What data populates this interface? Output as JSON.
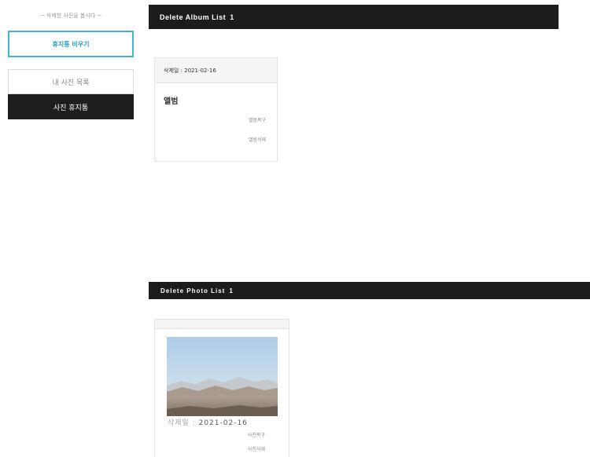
{
  "sidebar": {
    "hint": "~ 삭제한 사진을 봅시다 ~",
    "empty_trash_label": "휴지통 비우기",
    "nav": {
      "my_photos": "내 사진 목록",
      "photo_trash": "사진 휴지통"
    }
  },
  "album_section": {
    "title": "Delete Album List",
    "count": "1",
    "cards": [
      {
        "deleted_date": "삭제일 : 2021-02-16",
        "title": "앨범",
        "restore_label": "앨범복구",
        "delete_label": "앨범삭제"
      }
    ]
  },
  "photo_section": {
    "title": "Delete Photo List",
    "count": "1",
    "cards": [
      {
        "date_label": "삭제일 :",
        "date": "2021-02-16",
        "restore_label": "사진복구",
        "delete_label": "사진삭제"
      }
    ]
  },
  "colors": {
    "accent": "#3fb4d6",
    "dark_bar": "#1c1c1c"
  }
}
